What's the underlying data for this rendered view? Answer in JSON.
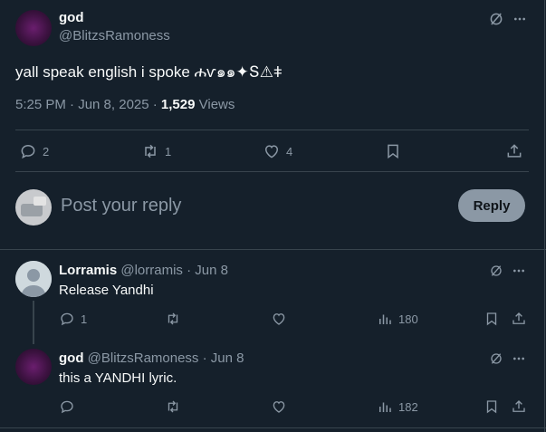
{
  "main_tweet": {
    "display_name": "god",
    "handle": "@BlitzsRamoness",
    "text": "yall speak english i spoke ሐѵ๑๑✦Տ⚠ǂ",
    "time": "5:25 PM · Jun 8, 2025 · ",
    "views_count": "1,529",
    "views_label": " Views",
    "reply_count": "2",
    "retweet_count": "1",
    "like_count": "4"
  },
  "composer": {
    "placeholder": "Post your reply",
    "reply_label": "Reply"
  },
  "replies": [
    {
      "display_name": "Lorramis",
      "handle_date": "@lorramis · Jun 8",
      "text": "Release Yandhi",
      "reply_count": "1",
      "views": "180"
    },
    {
      "display_name": "god",
      "handle_date": "@BlitzsRamoness · Jun 8",
      "text": "this a YANDHI lyric.",
      "views": "182"
    }
  ],
  "icons": [
    "grok-icon",
    "more-icon",
    "reply-icon",
    "retweet-icon",
    "like-icon",
    "bookmark-icon",
    "share-icon",
    "views-icon"
  ],
  "colors": {
    "background": "#15202b",
    "muted": "#8b98a5",
    "divider": "#38444d"
  }
}
